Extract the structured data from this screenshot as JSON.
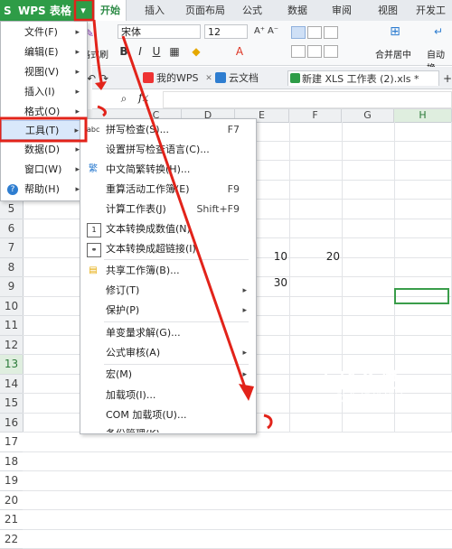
{
  "app": {
    "title": "WPS 表格"
  },
  "ribbon_tabs": [
    "开始",
    "插入",
    "页面布局",
    "公式",
    "数据",
    "审阅",
    "视图",
    "开发工"
  ],
  "ribbon": {
    "font_name": "宋体",
    "font_size": "12",
    "paste_label": "格式刷",
    "merge_label": "合并居中",
    "wrap_label": "自动换",
    "bold": "B",
    "italic": "I",
    "underline": "U",
    "font_grow": "A⁺",
    "font_shrink": "A⁻"
  },
  "doc_tabs": [
    "我的WPS",
    "云文档",
    "新建 XLS 工作表 (2).xls *"
  ],
  "formula_bar": {
    "fx": "fx"
  },
  "columns": [
    "C",
    "D",
    "E",
    "F",
    "G",
    "H"
  ],
  "rows": [
    "",
    "",
    "",
    "",
    "5",
    "6",
    "7",
    "8",
    "9",
    "10",
    "11",
    "12",
    "13",
    "14",
    "15",
    "16",
    "17",
    "18",
    "19",
    "20",
    "21",
    "22"
  ],
  "cells": {
    "e10": "10",
    "f10": "20",
    "e12": "30"
  },
  "main_menu": [
    {
      "label": "文件(F)"
    },
    {
      "label": "编辑(E)"
    },
    {
      "label": "视图(V)"
    },
    {
      "label": "插入(I)"
    },
    {
      "label": "格式(O)"
    },
    {
      "label": "工具(T)"
    },
    {
      "label": "数据(D)"
    },
    {
      "label": "窗口(W)"
    },
    {
      "label": "帮助(H)"
    }
  ],
  "tools_menu": [
    {
      "label": "拼写检查(S)...",
      "shortcut": "F7"
    },
    {
      "label": "设置拼写检查语言(C)...",
      "shortcut": ""
    },
    {
      "label": "中文简繁转换(H)...",
      "shortcut": ""
    },
    {
      "label": "重算活动工作簿(E)",
      "shortcut": "F9"
    },
    {
      "label": "计算工作表(J)",
      "shortcut": "Shift+F9"
    },
    {
      "label": "文本转换成数值(N)",
      "shortcut": ""
    },
    {
      "label": "文本转换成超链接(I)",
      "shortcut": ""
    },
    {
      "label": "共享工作簿(B)...",
      "shortcut": ""
    },
    {
      "label": "修订(T)",
      "shortcut": ""
    },
    {
      "label": "保护(P)",
      "shortcut": ""
    },
    {
      "label": "单变量求解(G)...",
      "shortcut": ""
    },
    {
      "label": "公式审核(A)",
      "shortcut": ""
    },
    {
      "label": "宏(M)",
      "shortcut": ""
    },
    {
      "label": "加载项(I)...",
      "shortcut": ""
    },
    {
      "label": "COM 加载项(U)...",
      "shortcut": ""
    },
    {
      "label": "备份管理(K)",
      "shortcut": ""
    }
  ],
  "watermark": {
    "title": "百科全说",
    "subtitle": "助你轻松解决"
  },
  "colors": {
    "brand_green": "#2e9c47",
    "annotation_red": "#e2231a",
    "selection_green": "#3a9d4a"
  }
}
